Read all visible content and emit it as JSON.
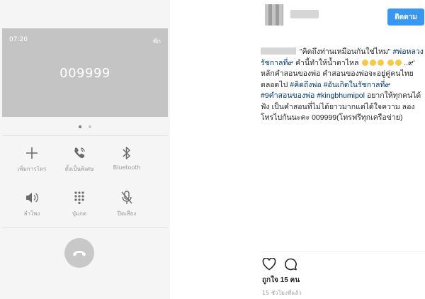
{
  "phone": {
    "clock": "07:20",
    "status": "พัก",
    "number": "009999",
    "controls": [
      {
        "label": "เพิ่มการโทร",
        "icon": "plus-icon"
      },
      {
        "label": "ตั้งเป็นพิเศษ",
        "icon": "phone-wave-icon"
      },
      {
        "label": "Bluetooth",
        "icon": "bluetooth-icon"
      },
      {
        "label": "ลำโพง",
        "icon": "speaker-icon"
      },
      {
        "label": "ปุ่มกด",
        "icon": "keypad-icon"
      },
      {
        "label": "ปิดเสียง",
        "icon": "mute-mic-icon"
      }
    ],
    "end_call_icon": "end-call-icon"
  },
  "instagram": {
    "follow_label": "ติดตาม",
    "caption": {
      "quote": "\"คิดถึงท่านเหมือนกันใช่ไหม\"",
      "tag1": "#พ่อหลวงรัชกาลที่๙",
      "text1": " คำนี้ทำให้น้ำตาไหล",
      "text2": " ..๙' หลักคำสอนของพ่อ คำสอนของพ่อจะอยู่คู่คนไทยตลอดไป",
      "tag2": "#คิดถึงพ่อ",
      "tag3": "#อันเกิดในรัชกาลที่๙",
      "tag4": "#9คำสอนของพ่อ",
      "tag5": "#kingbhumipol",
      "text3": " อยากให้ทุกคนได้ฟัง เป็นคำสอนที่ไม่ได้ยาวมากแต่ได้ใจความ ลองโทรไปกันนะคะ 009999(โทรฟรีทุกเครือข่าย)"
    },
    "likes": "ถูกใจ 15 คน",
    "time": "15 ชั่วโมงที่แล้ว",
    "accent_color": "#3897f0",
    "hashtag_color": "#003569",
    "icons": [
      "heart-icon",
      "comment-icon"
    ]
  }
}
